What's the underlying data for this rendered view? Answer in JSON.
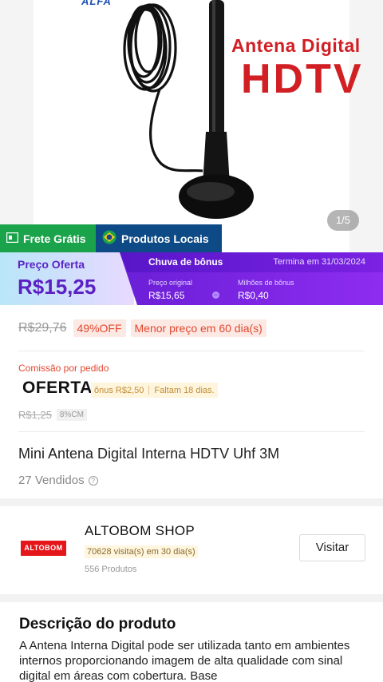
{
  "hero": {
    "brand": "ALFA",
    "title_line1": "Antena Digital",
    "title_line2": "HDTV",
    "image_counter": "1/5"
  },
  "badges": {
    "frete": "Frete Grátis",
    "locais": "Produtos Locais"
  },
  "price_banner": {
    "label": "Preço Oferta",
    "price": "R$15,25",
    "campaign_title": "Chuva de bônus",
    "ends": "Termina em 31/03/2024",
    "original_label": "Preço original",
    "original_value": "R$15,65",
    "bonus_label": "Milhões de bônus",
    "bonus_value": "R$0,40"
  },
  "pricing": {
    "old_price": "R$29,76",
    "discount": "49%OFF",
    "lowest": "Menor preço em 60 dia(s)"
  },
  "commission": {
    "label": "Comissão por pedido",
    "offer": "OFERTA",
    "bonus": "ônus R$2,50",
    "remaining": "Faltam 18 dias.",
    "old_value": "R$1,25",
    "cm_tag": "8%CM"
  },
  "product": {
    "title": "Mini Antena Digital Interna HDTV Uhf 3M",
    "sold": "27 Vendidos"
  },
  "shop": {
    "logo_text": "ALTOBOM",
    "name": "ALTOBOM SHOP",
    "visits": "70628 visita(s) em 30 dia(s)",
    "products": "556 Produtos",
    "visit_button": "Visitar"
  },
  "description": {
    "title": "Descrição do produto",
    "text": "A Antena Interna Digital  pode ser utilizada tanto em ambientes internos proporcionando imagem de alta qualidade com sinal digital em áreas com cobertura. Base"
  },
  "colors": {
    "discount_red": "#e2472e",
    "bonus_purple": "#6a1fd6",
    "frete_green": "#1aa34a",
    "locais_blue": "#0d4a86"
  }
}
